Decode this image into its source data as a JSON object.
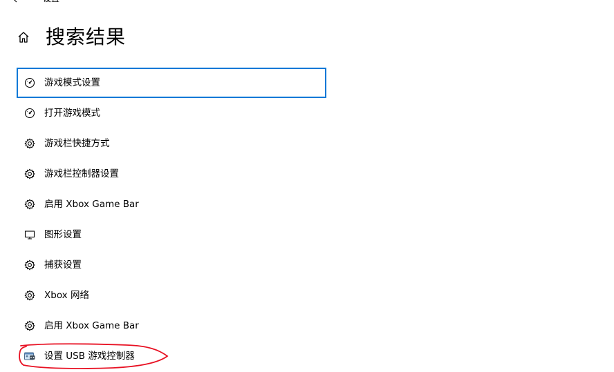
{
  "window": {
    "title": "设置"
  },
  "header": {
    "title": "搜索结果"
  },
  "results": [
    {
      "label": "游戏模式设置",
      "icon": "gauge-icon",
      "selected": true
    },
    {
      "label": "打开游戏模式",
      "icon": "gauge-icon",
      "selected": false
    },
    {
      "label": "游戏栏快捷方式",
      "icon": "gear-icon",
      "selected": false
    },
    {
      "label": "游戏栏控制器设置",
      "icon": "gear-icon",
      "selected": false
    },
    {
      "label": "启用 Xbox Game Bar",
      "icon": "gear-icon",
      "selected": false
    },
    {
      "label": "图形设置",
      "icon": "monitor-icon",
      "selected": false
    },
    {
      "label": "捕获设置",
      "icon": "gear-icon",
      "selected": false
    },
    {
      "label": "Xbox 网络",
      "icon": "gear-icon",
      "selected": false
    },
    {
      "label": "启用 Xbox Game Bar",
      "icon": "gear-icon",
      "selected": false
    },
    {
      "label": "设置 USB 游戏控制器",
      "icon": "game-controller-icon",
      "selected": false
    }
  ],
  "colors": {
    "selection_border": "#0078d7",
    "annotation": "#e81123"
  }
}
